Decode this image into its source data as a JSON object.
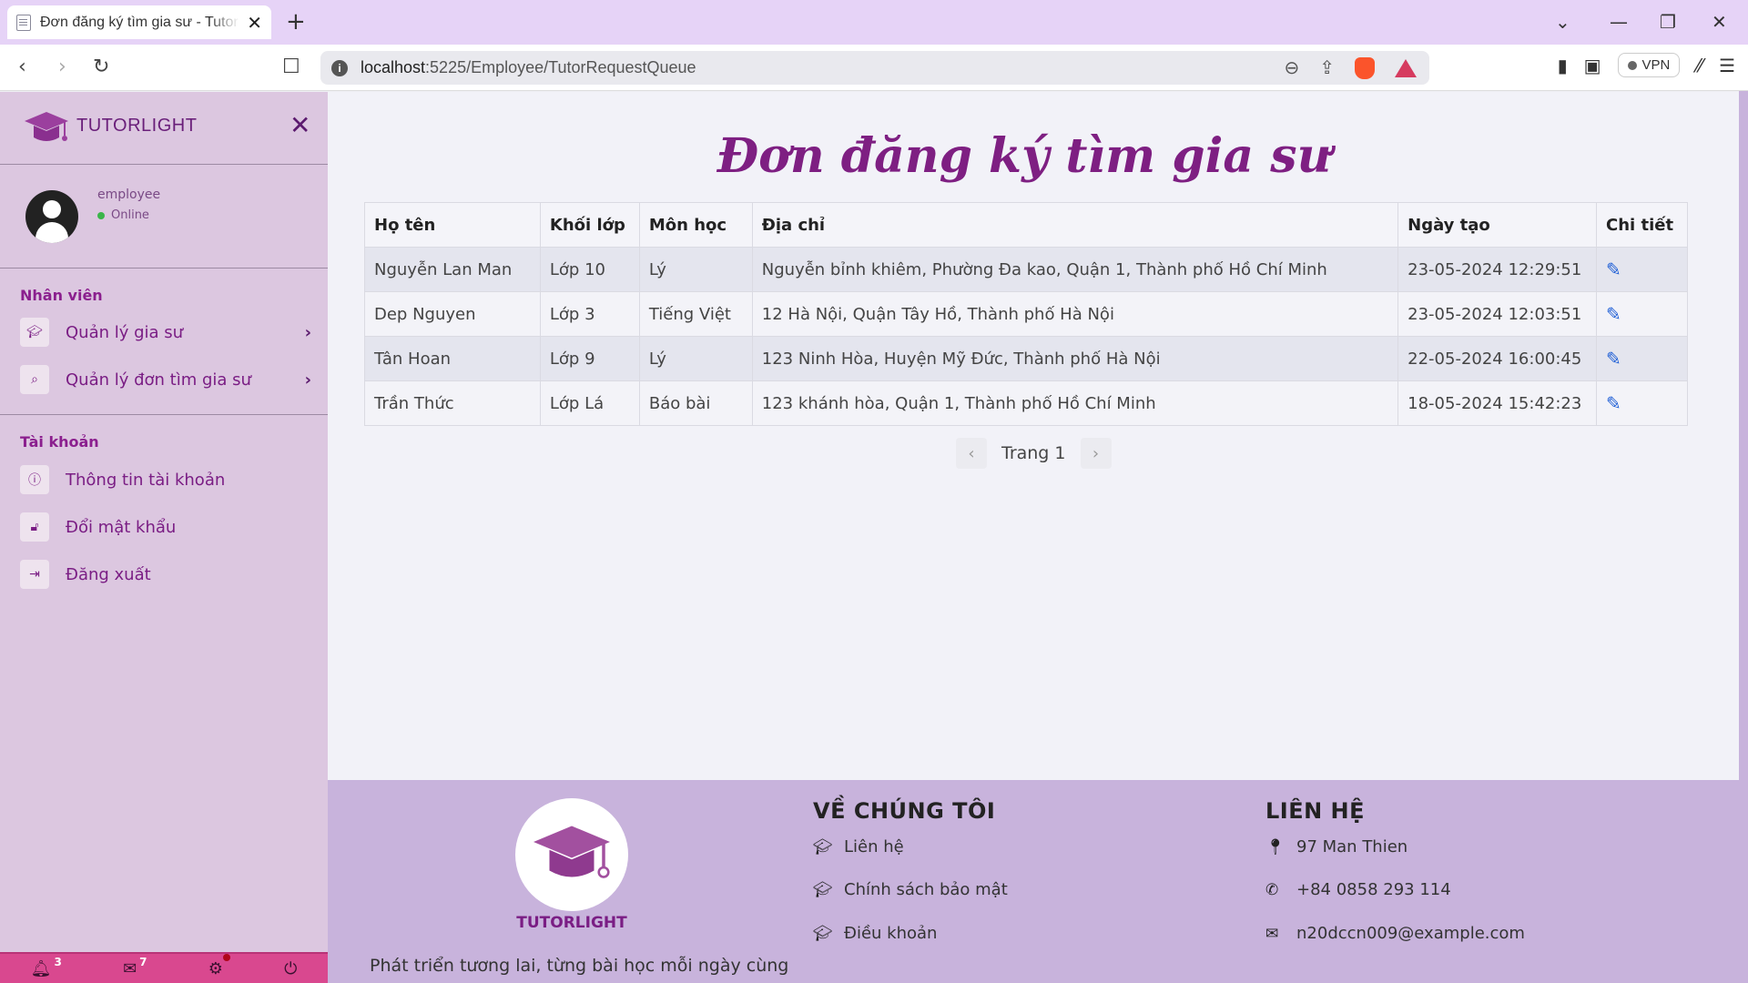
{
  "browser": {
    "tab_title": "Đơn đăng ký tìm gia sư - TutorLight",
    "tab_close": "✕",
    "new_tab": "+",
    "url_host": "localhost",
    "url_path": ":5225/Employee/TutorRequestQueue",
    "vpn_label": "VPN"
  },
  "sidebar": {
    "brand": "TUTORLIGHT",
    "close": "✕",
    "user": {
      "name": "employee",
      "status": "Online"
    },
    "sections": [
      {
        "title": "Nhân viên"
      },
      {
        "title": "Tài khoản"
      }
    ],
    "employee_items": [
      {
        "label": "Quản lý gia sư",
        "icon": "graduation-cap-icon"
      },
      {
        "label": "Quản lý đơn tìm gia sư",
        "icon": "search-icon"
      }
    ],
    "account_items": [
      {
        "label": "Thông tin tài khoản",
        "icon": "info-icon"
      },
      {
        "label": "Đổi mật khẩu",
        "icon": "unlock-icon"
      },
      {
        "label": "Đăng xuất",
        "icon": "sign-out-icon"
      }
    ],
    "footer": {
      "notifications": "3",
      "messages": "7"
    }
  },
  "main": {
    "title": "Đơn đăng ký tìm gia sư",
    "columns": [
      "Họ tên",
      "Khối lớp",
      "Môn học",
      "Địa chỉ",
      "Ngày tạo",
      "Chi tiết"
    ],
    "rows": [
      [
        "Nguyễn Lan Man",
        "Lớp 10",
        "Lý",
        "Nguyễn bỉnh khiêm, Phường Đa kao, Quận 1, Thành phố Hồ Chí Minh",
        "23-05-2024 12:29:51"
      ],
      [
        "Dep Nguyen",
        "Lớp 3",
        "Tiếng Việt",
        "12 Hà Nội, Quận Tây Hồ, Thành phố Hà Nội",
        "23-05-2024 12:03:51"
      ],
      [
        "Tân Hoan",
        "Lớp 9",
        "Lý",
        "123 Ninh Hòa, Huyện Mỹ Đức, Thành phố Hà Nội",
        "22-05-2024 16:00:45"
      ],
      [
        "Trần Thức",
        "Lớp Lá",
        "Báo bài",
        "123 khánh hòa, Quận 1, Thành phố Hồ Chí Minh",
        "18-05-2024 15:42:23"
      ]
    ],
    "pager": {
      "label": "Trang 1"
    }
  },
  "footer": {
    "brand": "TUTORLIGHT",
    "tagline": "Phát triển tương lai, từng bài học mỗi ngày cùng",
    "about_title": "VỀ CHÚNG TÔI",
    "about_links": [
      "Liên hệ",
      "Chính sách bảo mật",
      "Điều khoản"
    ],
    "contact_title": "LIÊN HỆ",
    "contact_address": "97 Man Thien",
    "contact_phone": "+84 0858 293 114",
    "contact_email": "n20dccn009@example.com"
  },
  "colors": {
    "brand_purple": "#7e1f82",
    "sidebar_bg": "#dcc7e0",
    "footer_bg": "#c8b3dc",
    "sidebar_footer_bg": "#d9488f",
    "edit_icon": "#1f5fd6"
  }
}
